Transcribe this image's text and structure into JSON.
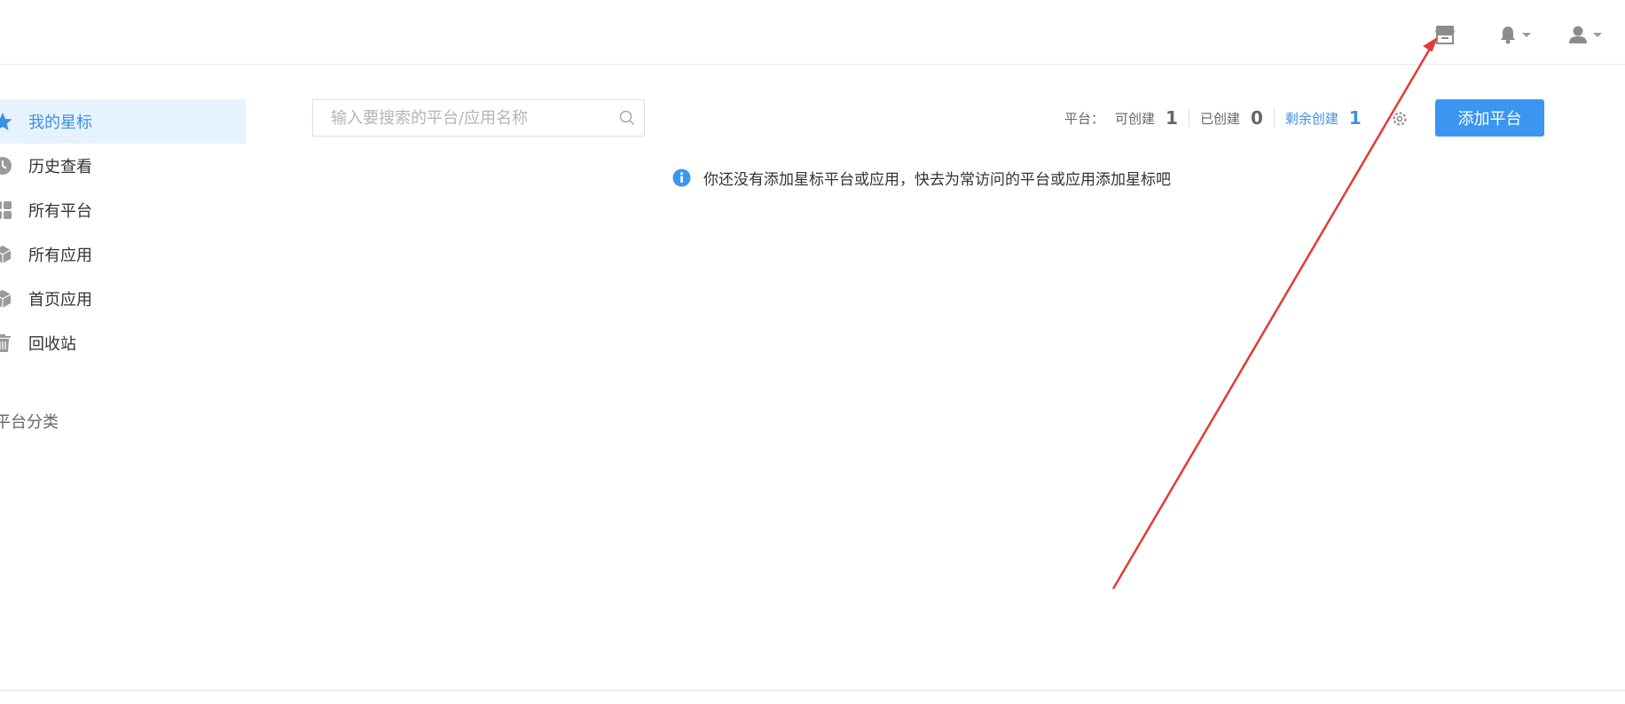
{
  "sidebar": {
    "items": [
      {
        "label": "我的星标",
        "icon": "star-icon",
        "active": true
      },
      {
        "label": "历史查看",
        "icon": "clock-icon"
      },
      {
        "label": "所有平台",
        "icon": "grid-icon"
      },
      {
        "label": "所有应用",
        "icon": "cube-icon"
      },
      {
        "label": "首页应用",
        "icon": "cube-icon"
      },
      {
        "label": "回收站",
        "icon": "trash-icon"
      }
    ],
    "section_title": "平台分类"
  },
  "search": {
    "placeholder": "输入要搜索的平台/应用名称"
  },
  "stats": {
    "prefix": "平台：",
    "can_create_label": "可创建",
    "can_create_value": "1",
    "created_label": "已创建",
    "created_value": "0",
    "remaining_label": "剩余创建",
    "remaining_value": "1"
  },
  "toolbar": {
    "add_platform_label": "添加平台"
  },
  "notice": {
    "text": "你还没有添加星标平台或应用，快去为常访问的平台或应用添加星标吧"
  },
  "colors": {
    "accent": "#3a96f1",
    "active_bg": "#e6f3ff",
    "annotation": "#e53935"
  }
}
